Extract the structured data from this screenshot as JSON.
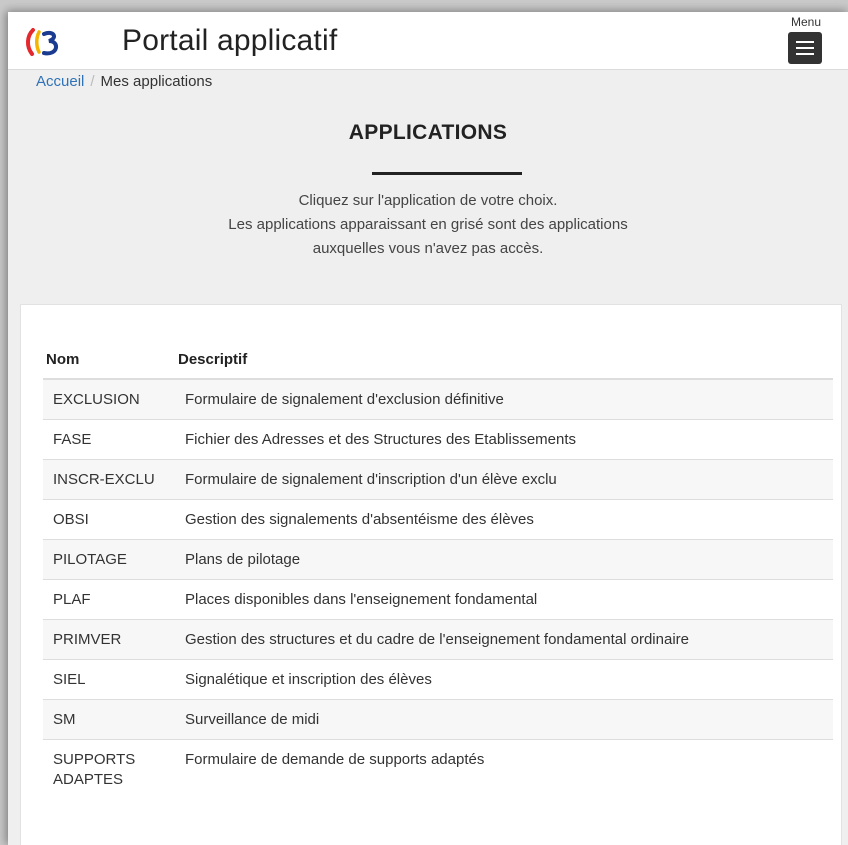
{
  "header": {
    "title": "Portail applicatif",
    "menu_label": "Menu",
    "logo_colors": [
      "#e4282d",
      "#f4b400",
      "#1a3b8f"
    ]
  },
  "breadcrumb": {
    "home": "Accueil",
    "current": "Mes applications"
  },
  "main": {
    "heading": "APPLICATIONS",
    "intro_line1": "Cliquez sur l'application de votre choix.",
    "intro_line2": "Les applications apparaissant en grisé sont des applications",
    "intro_line3": "auxquelles vous n'avez pas accès."
  },
  "table": {
    "headers": {
      "nom": "Nom",
      "descriptif": "Descriptif"
    },
    "rows": [
      {
        "code": "EXCLUSION",
        "description": "Formulaire de signalement d'exclusion définitive"
      },
      {
        "code": "FASE",
        "description": "Fichier des Adresses et des Structures des Etablissements"
      },
      {
        "code": "INSCR-EXCLU",
        "description": "Formulaire de signalement d'inscription d'un élève exclu"
      },
      {
        "code": "OBSI",
        "description": "Gestion des signalements d'absentéisme des élèves"
      },
      {
        "code": "PILOTAGE",
        "description": "Plans de pilotage"
      },
      {
        "code": "PLAF",
        "description": "Places disponibles dans l'enseignement fondamental"
      },
      {
        "code": "PRIMVER",
        "description": "Gestion des structures et du cadre de l'enseignement fondamental ordinaire"
      },
      {
        "code": "SIEL",
        "description": "Signalétique et inscription des élèves"
      },
      {
        "code": "SM",
        "description": "Surveillance de midi"
      },
      {
        "code": "SUPPORTS ADAPTES",
        "description": "Formulaire de demande de supports adaptés"
      }
    ]
  }
}
